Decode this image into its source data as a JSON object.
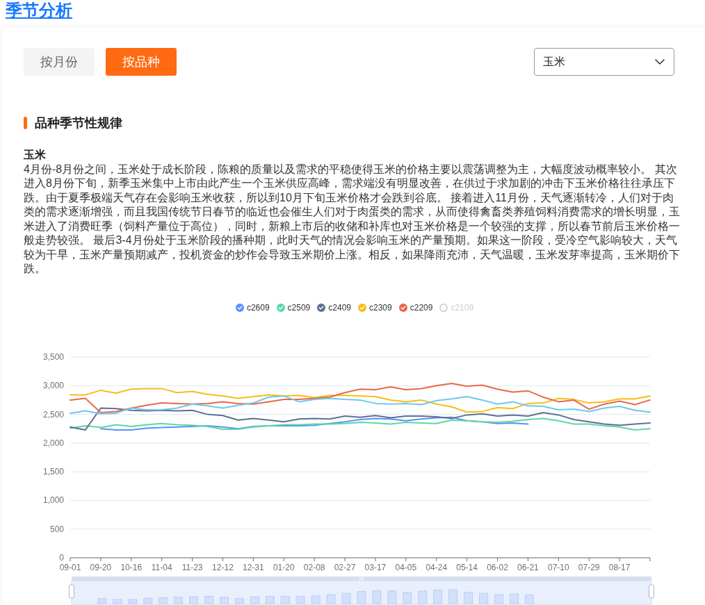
{
  "page_title": "季节分析",
  "tabs": [
    {
      "label": "按月份",
      "selected": false
    },
    {
      "label": "按品种",
      "selected": true
    }
  ],
  "variety_select": {
    "value": "玉米"
  },
  "section": {
    "title": "品种季节性规律",
    "variety": "玉米",
    "description": "4月份-8月份之间，玉米处于成长阶段，陈粮的质量以及需求的平稳使得玉米的价格主要以震荡调整为主，大幅度波动概率较小。 其次进入8月份下旬，新季玉米集中上市由此产生一个玉米供应高峰，需求端没有明显改善，在供过于求加剧的冲击下玉米价格往往承压下跌。由于夏季极端天气存在会影响玉米收获，所以到10月下旬玉米价格才会跌到谷底。 接着进入11月份，天气逐渐转冷，人们对于肉类的需求逐渐增强，而且我国传统节日春节的临近也会催生人们对于肉蛋类的需求，从而使得禽畜类养殖饲料消费需求的增长明显，玉米进入了消费旺季（饲料产量位于高位），同时，新粮上市后的收储和补库也对玉米价格是一个较强的支撑，所以春节前后玉米价格一般走势较强。 最后3-4月份处于玉米阶段的播种期，此时天气的情况会影响玉米的产量预期。如果这一阶段，受冷空气影响较大，天气较为干旱，玉米产量预期减产，投机资金的炒作会导致玉米期价上涨。相反，如果降雨充沛，天气温暖，玉米发芽率提高，玉米期价下跌。"
  },
  "chart": {
    "legend_items": [
      {
        "selected": true
      },
      {
        "selected": true
      },
      {
        "selected": true
      },
      {
        "selected": true
      },
      {
        "selected": true
      },
      {
        "label": "c2109",
        "selected": false
      }
    ],
    "chart_data": {
      "type": "line",
      "legend": true,
      "grid": true,
      "categories": [
        "09-01",
        null,
        "09-20",
        null,
        "10-16",
        null,
        "11-04",
        null,
        "11-23",
        null,
        "12-12",
        null,
        "12-31",
        null,
        "01-20",
        null,
        "02-08",
        null,
        "02-27",
        null,
        "03-17",
        null,
        "04-05",
        null,
        "04-24",
        null,
        "05-14",
        null,
        "06-02",
        null,
        "06-21",
        null,
        "07-10",
        null,
        "07-29",
        null,
        "08-17",
        null,
        null
      ],
      "ylim": [
        0,
        3500
      ],
      "yticks": [
        {
          "value": 0,
          "label": "0"
        },
        {
          "value": 500,
          "label": "500"
        },
        {
          "value": 1000,
          "label": "1,000"
        },
        {
          "value": 1500,
          "label": "1,500"
        },
        {
          "value": 2000,
          "label": "2,000"
        },
        {
          "value": 2500,
          "label": "2,500"
        },
        {
          "value": 3000,
          "label": "3,000"
        },
        {
          "value": 3500,
          "label": "3,500"
        }
      ],
      "series": [
        {
          "name": "c2609",
          "color": "#5b8ff9",
          "values": [
            null,
            null,
            2250,
            2230,
            2230,
            2260,
            2270,
            2280,
            2290,
            2300,
            2280,
            2250,
            2290,
            2300,
            2300,
            2300,
            2310,
            2340,
            2370,
            2410,
            2430,
            2420,
            2390,
            2420,
            2440,
            2450,
            2390,
            2370,
            2340,
            2350,
            2330,
            null,
            null,
            null,
            null,
            null,
            null,
            null,
            null
          ]
        },
        {
          "name": "c2509",
          "color": "#5ad8a6",
          "values": [
            2260,
            2300,
            2270,
            2320,
            2290,
            2320,
            2340,
            2320,
            2310,
            2290,
            2240,
            2240,
            2280,
            2300,
            2320,
            2320,
            2330,
            2330,
            2340,
            2360,
            2350,
            2330,
            2360,
            2350,
            2340,
            2400,
            2390,
            2370,
            2360,
            2380,
            2410,
            2430,
            2390,
            2330,
            2330,
            2300,
            2280,
            2230,
            2250
          ]
        },
        {
          "name": "c2409",
          "color": "#5d7092",
          "values": [
            2280,
            2230,
            2610,
            2600,
            2570,
            2560,
            2570,
            2560,
            2570,
            2500,
            2480,
            2400,
            2430,
            2400,
            2370,
            2420,
            2430,
            2420,
            2470,
            2450,
            2480,
            2440,
            2470,
            2470,
            2460,
            2430,
            2490,
            2510,
            2470,
            2490,
            2470,
            2530,
            2490,
            2410,
            2370,
            2330,
            2310,
            2330,
            2350
          ]
        },
        {
          "name": "c2309",
          "color": "#f6bd16",
          "values": [
            2840,
            2840,
            2920,
            2870,
            2940,
            2950,
            2950,
            2880,
            2900,
            2850,
            2820,
            2780,
            2810,
            2840,
            2820,
            2830,
            2790,
            2830,
            2830,
            2820,
            2810,
            2750,
            2720,
            2750,
            2680,
            2630,
            2540,
            2550,
            2620,
            2600,
            2690,
            2700,
            2780,
            2760,
            2700,
            2720,
            2770,
            2770,
            2820
          ]
        },
        {
          "name": "c2209",
          "color": "#e8684a",
          "values": [
            2750,
            2780,
            2530,
            2550,
            2610,
            2660,
            2700,
            2690,
            2680,
            2690,
            2720,
            2690,
            2680,
            2720,
            2760,
            2760,
            2780,
            2800,
            2880,
            2940,
            2930,
            2980,
            2930,
            2950,
            3000,
            3040,
            2990,
            3010,
            2940,
            2890,
            2910,
            2800,
            2720,
            2750,
            2590,
            2680,
            2730,
            2670,
            2750
          ]
        },
        {
          "color": "#6dc8ec",
          "values": [
            2520,
            2560,
            2510,
            2520,
            2610,
            2580,
            2580,
            2610,
            2680,
            2650,
            2610,
            2660,
            2700,
            2800,
            2820,
            2720,
            2760,
            2780,
            2760,
            2750,
            2690,
            2680,
            2690,
            2670,
            2740,
            2770,
            2810,
            2750,
            2680,
            2720,
            2650,
            2640,
            2580,
            2590,
            2550,
            2610,
            2640,
            2570,
            2540
          ]
        }
      ]
    }
  }
}
